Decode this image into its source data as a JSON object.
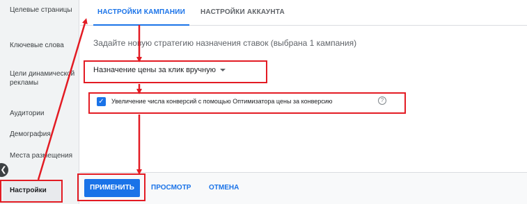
{
  "sidebar": {
    "items": [
      {
        "label": "Целевые страницы"
      },
      {
        "label": "Ключевые слова"
      },
      {
        "label": "Цели динамической рекламы"
      },
      {
        "label": "Аудитории"
      },
      {
        "label": "Демография"
      },
      {
        "label": "Места размещения"
      },
      {
        "label": "Настройки"
      }
    ],
    "collapse_glyph": "❮"
  },
  "tabs": [
    {
      "label": "НАСТРОЙКИ КАМПАНИИ",
      "active": true
    },
    {
      "label": "НАСТРОЙКИ АККАУНТА",
      "active": false
    }
  ],
  "main": {
    "strategy_description": "Задайте новую стратегию назначения ставок (выбрана 1 кампания)",
    "bid_strategy_select": "Назначение цены за клик вручную",
    "enhanced_cpc_checkbox": {
      "checked": true,
      "check_glyph": "✓",
      "label": "Увеличение числа конверсий с помощью Оптимизатора цены за конверсию"
    },
    "help_glyph": "?"
  },
  "footer": {
    "apply_label": "ПРИМЕНИТЬ",
    "preview_label": "ПРОСМОТР",
    "cancel_label": "ОТМЕНА"
  },
  "colors": {
    "accent": "#1a73e8",
    "annotation": "#e31b23",
    "sidebar_bg": "#f1f3f4"
  }
}
